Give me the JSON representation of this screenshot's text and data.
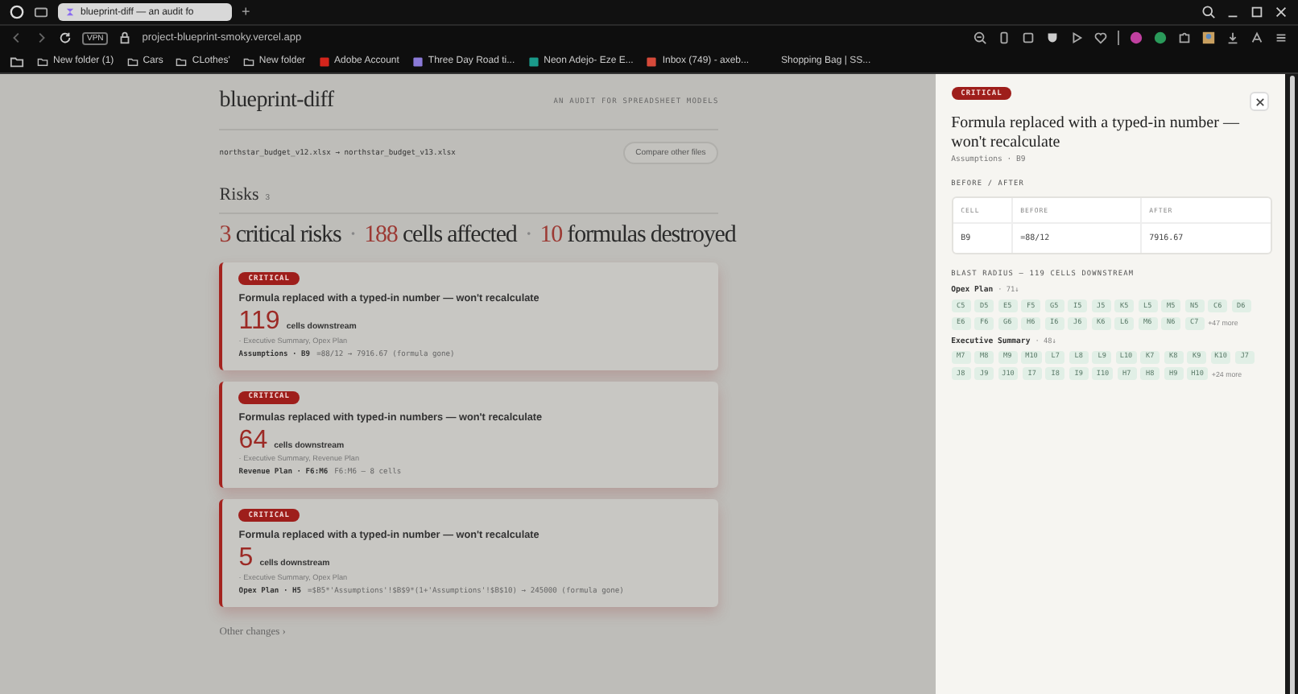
{
  "browser": {
    "tab_title": "blueprint-diff — an audit fo",
    "new_tab": "+",
    "vpn": "VPN",
    "url": "project-blueprint-smoky.vercel.app",
    "bookmarks": [
      {
        "label": "New folder (1)",
        "kind": "folder"
      },
      {
        "label": "Cars",
        "kind": "folder"
      },
      {
        "label": "CLothes'",
        "kind": "folder"
      },
      {
        "label": "New folder",
        "kind": "folder"
      },
      {
        "label": "Adobe Account",
        "kind": "adobe"
      },
      {
        "label": "Three Day Road ti...",
        "kind": "letter"
      },
      {
        "label": "Neon Adejo- Eze E...",
        "kind": "teal"
      },
      {
        "label": "Inbox (749) - axeb...",
        "kind": "mail"
      },
      {
        "label": "Shopping Bag | SS...",
        "kind": "none"
      }
    ]
  },
  "page": {
    "brand": "blueprint-diff",
    "tagline": "AN AUDIT FOR SPREADSHEET MODELS",
    "files": "northstar_budget_v12.xlsx → northstar_budget_v13.xlsx",
    "compare_button": "Compare other files",
    "section_title": "Risks",
    "section_count": "3",
    "summary_separator": "·",
    "summary": [
      {
        "count": "3",
        "noun": "critical risks"
      },
      {
        "count": "188",
        "noun": "cells affected"
      },
      {
        "count": "10",
        "noun": "formulas destroyed"
      }
    ],
    "risks": [
      {
        "badge": "CRITICAL",
        "title": "Formula replaced with a typed-in number — won't recalculate",
        "count": "119",
        "count_label": "cells downstream",
        "sheets": "· Executive Summary, Opex Plan",
        "location": "Assumptions · B9",
        "detail": "=88/12 → 7916.67 (formula gone)"
      },
      {
        "badge": "CRITICAL",
        "title": "Formulas replaced with typed-in numbers — won't recalculate",
        "count": "64",
        "count_label": "cells downstream",
        "sheets": "· Executive Summary, Revenue Plan",
        "location": "Revenue Plan · F6:M6",
        "detail": "F6:M6 — 8 cells"
      },
      {
        "badge": "CRITICAL",
        "title": "Formula replaced with a typed-in number — won't recalculate",
        "count": "5",
        "count_label": "cells downstream",
        "sheets": "· Executive Summary, Opex Plan",
        "location": "Opex Plan · H5",
        "detail": "=$B5*'Assumptions'!$B$9*(1+'Assumptions'!$B$10) → 245000 (formula gone)"
      }
    ],
    "other_changes": "Other changes ›"
  },
  "panel": {
    "badge": "CRITICAL",
    "title": "Formula replaced with a typed-in number — won't recalculate",
    "subtitle": "Assumptions · B9",
    "before_after_heading": "BEFORE / AFTER",
    "table": {
      "columns": [
        "CELL",
        "BEFORE",
        "AFTER"
      ],
      "rows": [
        [
          "B9",
          "=88/12",
          "7916.67"
        ]
      ]
    },
    "blast_heading": "BLAST RADIUS — 119 CELLS DOWNSTREAM",
    "groups": [
      {
        "sheet": "Opex Plan",
        "count": "· 71↓",
        "cells": [
          "C5",
          "D5",
          "E5",
          "F5",
          "G5",
          "I5",
          "J5",
          "K5",
          "L5",
          "M5",
          "N5",
          "C6",
          "D6",
          "E6",
          "F6",
          "G6",
          "H6",
          "I6",
          "J6",
          "K6",
          "L6",
          "M6",
          "N6",
          "C7"
        ],
        "more": "+47 more"
      },
      {
        "sheet": "Executive Summary",
        "count": "· 48↓",
        "cells": [
          "M7",
          "M8",
          "M9",
          "M10",
          "L7",
          "L8",
          "L9",
          "L10",
          "K7",
          "K8",
          "K9",
          "K10",
          "J7",
          "J8",
          "J9",
          "J10",
          "I7",
          "I8",
          "I9",
          "I10",
          "H7",
          "H8",
          "H9",
          "H10"
        ],
        "more": "+24 more"
      }
    ]
  }
}
